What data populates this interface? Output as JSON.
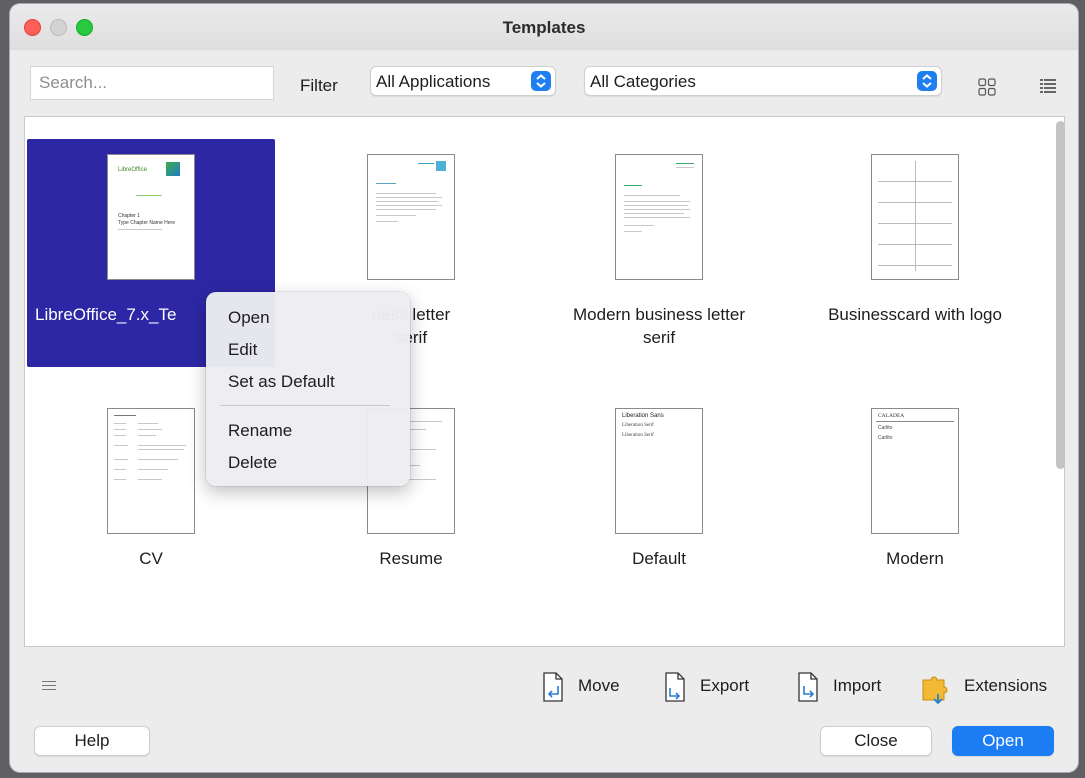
{
  "window": {
    "title": "Templates"
  },
  "search": {
    "placeholder": "Search..."
  },
  "filter": {
    "label": "Filter",
    "application": "All Applications",
    "category": "All Categories"
  },
  "view_icons": [
    "grid-view-icon",
    "list-view-icon"
  ],
  "templates": [
    {
      "name": "LibreOffice_7.x_Te",
      "selected": true,
      "thumb": "chapter-doc"
    },
    {
      "name": "ness letter",
      "name2": "serif",
      "thumb": "letter"
    },
    {
      "name": "Modern business letter",
      "name2": "serif",
      "thumb": "letter"
    },
    {
      "name": "Businesscard with logo",
      "thumb": "cards"
    },
    {
      "name": "CV",
      "thumb": "cv"
    },
    {
      "name": "Resume",
      "thumb": "resume"
    },
    {
      "name": "Default",
      "thumb": "default"
    },
    {
      "name": "Modern",
      "thumb": "modern"
    }
  ],
  "thumb_text": {
    "t0_brand": "LibreOffice",
    "t0_heading": "Chapter 1",
    "t0_sub": "Type Chapter Name Here",
    "t6_title": "Liberation Sans",
    "t6_l1": "Liberation Serif",
    "t6_l2": "Liberation Serif",
    "t7_title": "CALADEA",
    "t7_l1": "Carlito",
    "t7_l2": "Carlito"
  },
  "context_menu": {
    "items": [
      "Open",
      "Edit",
      "Set as Default",
      "Rename",
      "Delete"
    ]
  },
  "actions": {
    "move": "Move",
    "export": "Export",
    "import": "Import",
    "extensions": "Extensions"
  },
  "buttons": {
    "help": "Help",
    "close": "Close",
    "open": "Open"
  },
  "colors": {
    "selection": "#2d27a5",
    "accent": "#1c7cf4",
    "close_dot": "#ff5f57",
    "max_dot": "#28c840"
  }
}
